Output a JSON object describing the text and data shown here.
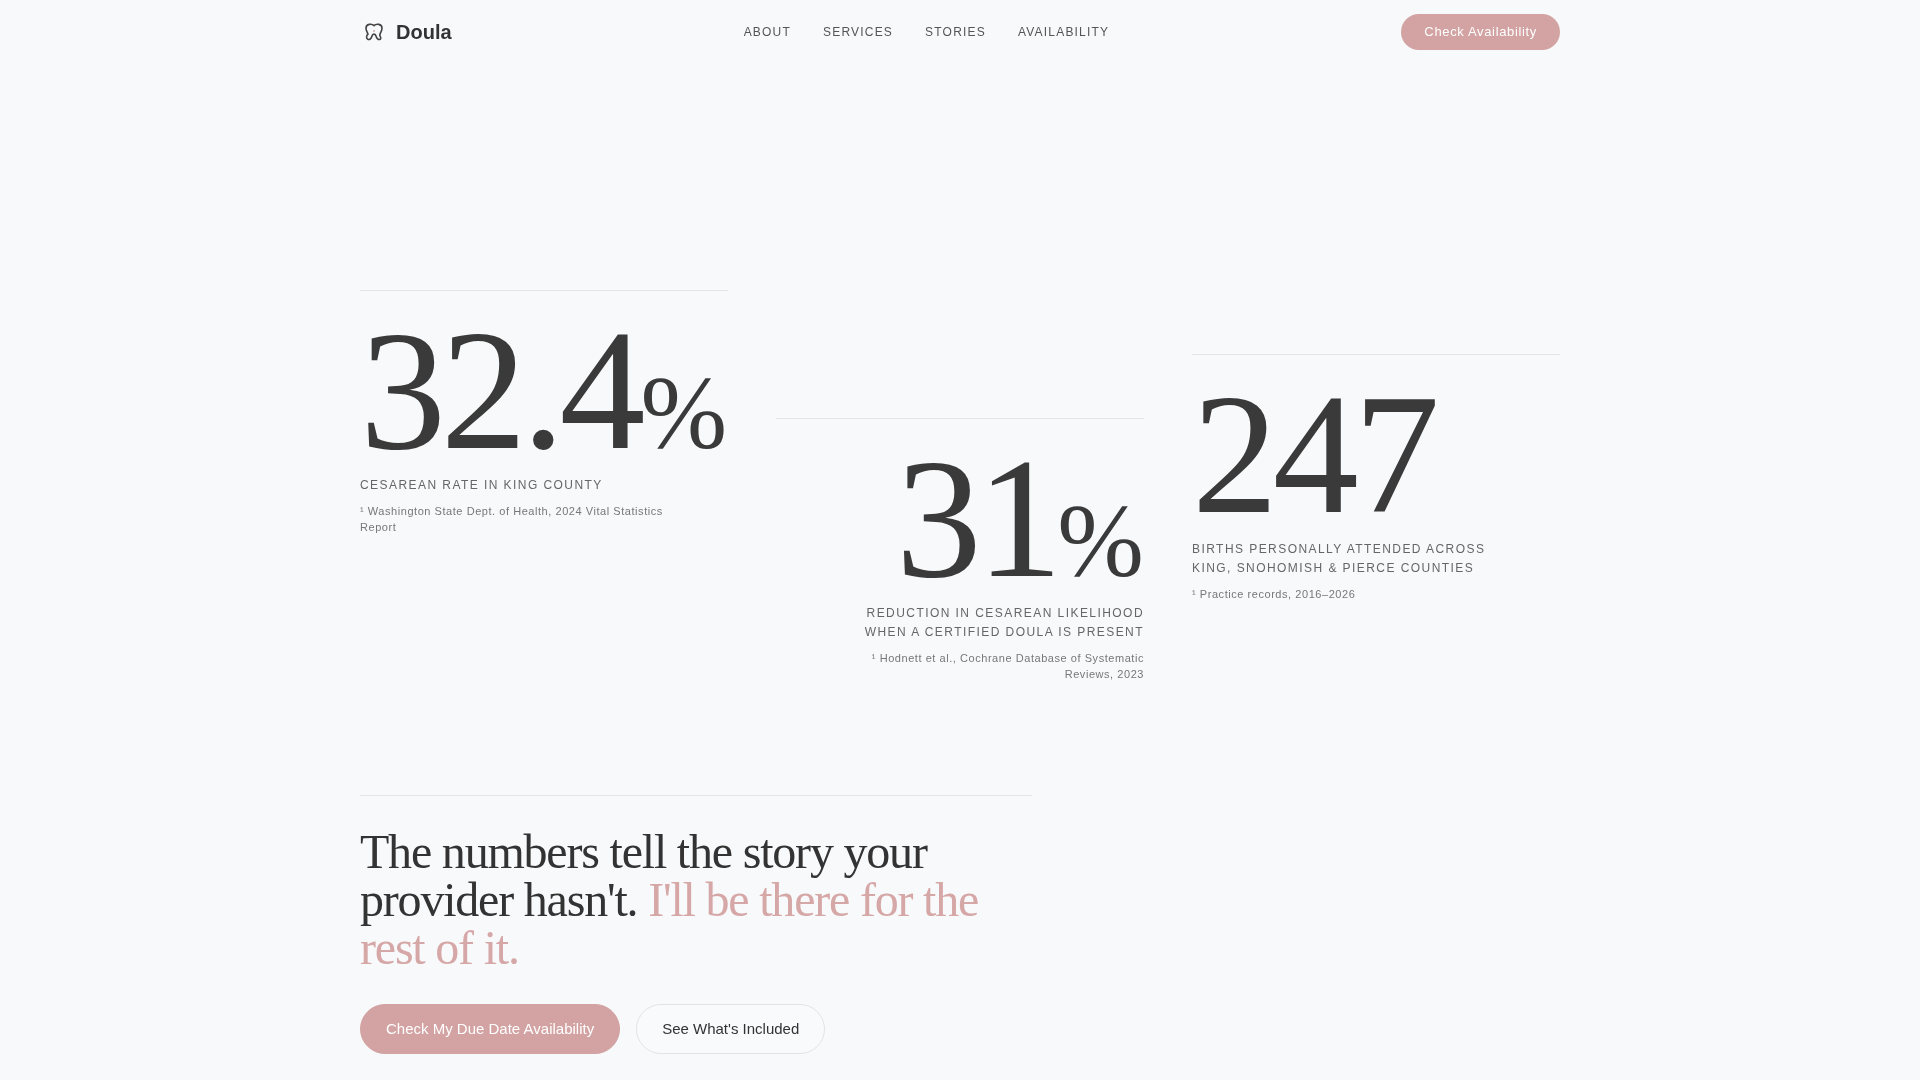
{
  "header": {
    "brand": "Doula",
    "nav": [
      "ABOUT",
      "SERVICES",
      "STORIES",
      "AVAILABILITY"
    ],
    "cta": "Check Availability"
  },
  "stats": [
    {
      "figure": "32.4",
      "unit": "%",
      "caption": "CESAREAN RATE IN KING COUNTY",
      "footnote": "¹ Washington State Dept. of Health, 2024 Vital Statistics Report"
    },
    {
      "figure": "31",
      "unit": "%",
      "caption": "REDUCTION IN CESAREAN LIKELIHOOD WHEN A CERTIFIED DOULA IS PRESENT",
      "footnote": "¹ Hodnett et al., Cochrane Database of Systematic Reviews, 2023"
    },
    {
      "figure": "247",
      "caption": "BIRTHS PERSONALLY ATTENDED ACROSS KING, SNOHOMISH & PIERCE COUNTIES",
      "footnote": "¹ Practice records, 2016–2026"
    }
  ],
  "closing": {
    "headline": "The numbers tell the story your provider hasn't.",
    "headline_accent": "I'll be there for the rest of it.",
    "buttons": [
      {
        "label": "Check My Due Date Availability",
        "kind": "primary"
      },
      {
        "label": "See What's Included",
        "kind": "secondary"
      }
    ]
  }
}
